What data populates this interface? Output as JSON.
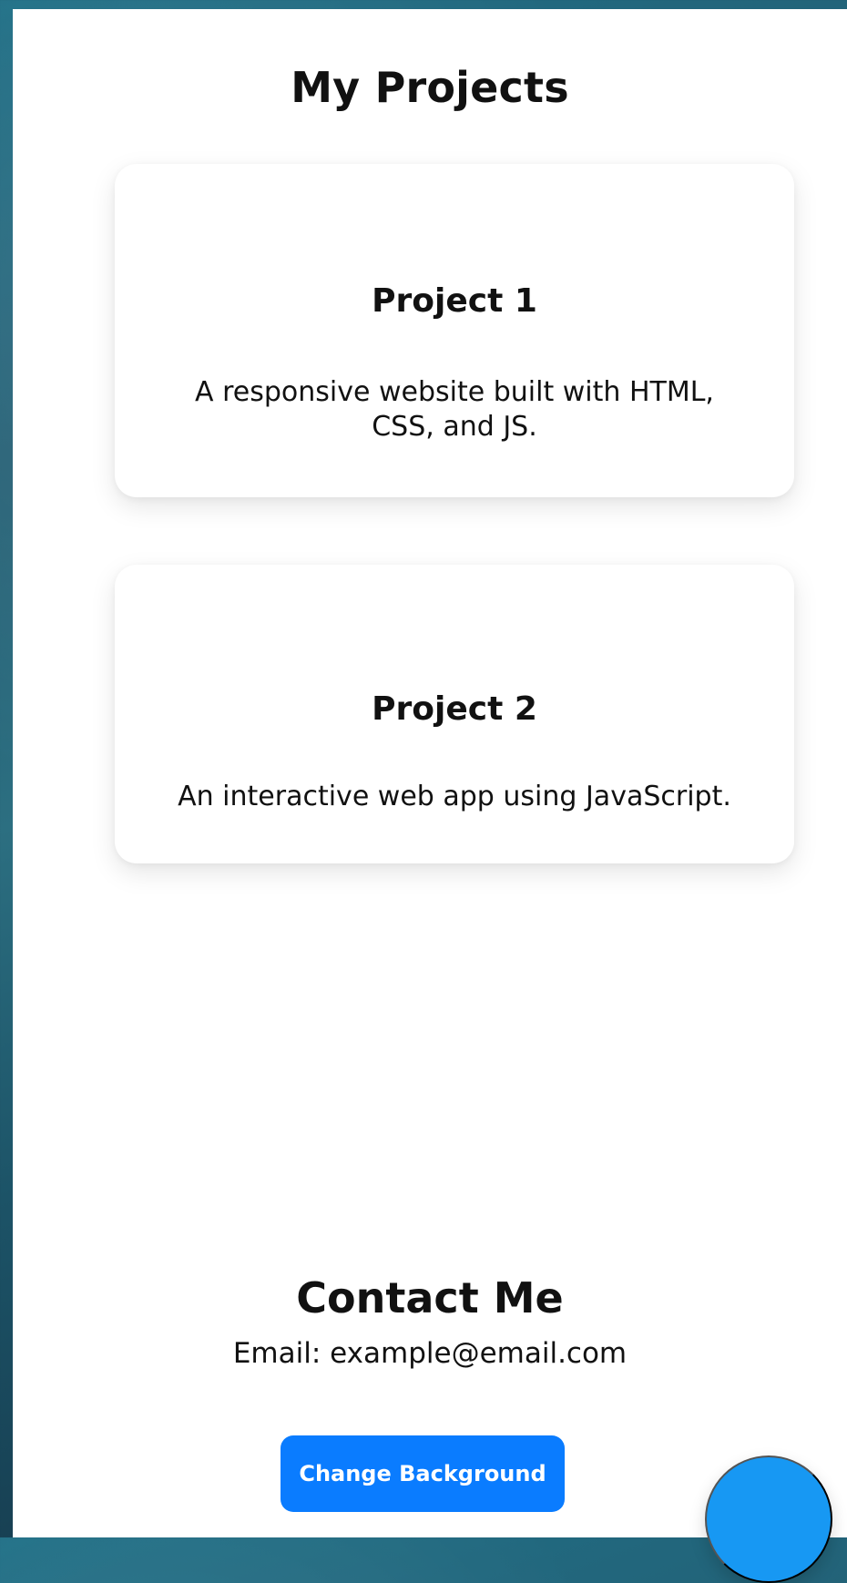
{
  "page": {
    "title": "My Projects"
  },
  "projects": [
    {
      "title": "Project 1",
      "description": "A responsive website built with HTML, CSS, and JS."
    },
    {
      "title": "Project 2",
      "description": "An interactive web app using JavaScript."
    }
  ],
  "contact": {
    "title": "Contact Me",
    "email": "Email: example@email.com"
  },
  "actions": {
    "change_background_label": "Change Background"
  },
  "colors": {
    "button_blue": "#0a7cff",
    "fab_blue": "#1798f3"
  }
}
